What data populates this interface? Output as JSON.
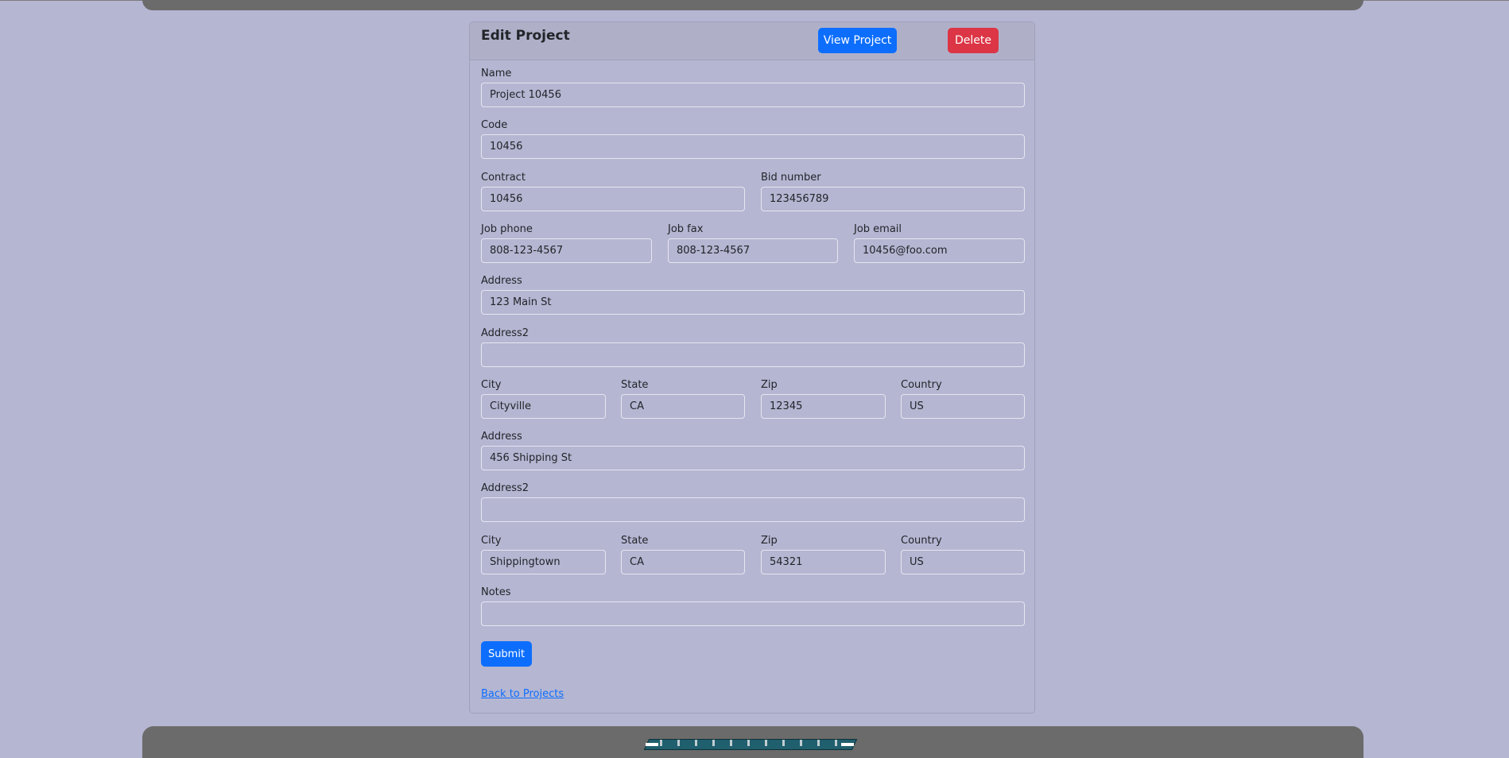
{
  "header": {
    "title": "Edit Project",
    "view_label": "View Project",
    "delete_label": "Delete"
  },
  "form": {
    "name": {
      "label": "Name",
      "value": "Project 10456"
    },
    "code": {
      "label": "Code",
      "value": "10456"
    },
    "contract": {
      "label": "Contract",
      "value": "10456"
    },
    "bid_number": {
      "label": "Bid number",
      "value": "123456789"
    },
    "job_phone": {
      "label": "Job phone",
      "value": "808-123-4567"
    },
    "job_fax": {
      "label": "Job fax",
      "value": "808-123-4567"
    },
    "job_email": {
      "label": "Job email",
      "value": "10456@foo.com"
    },
    "address": {
      "label": "Address",
      "value": "123 Main St"
    },
    "address2": {
      "label": "Address2",
      "value": ""
    },
    "city": {
      "label": "City",
      "value": "Cityville"
    },
    "state": {
      "label": "State",
      "value": "CA"
    },
    "zip": {
      "label": "Zip",
      "value": "12345"
    },
    "country": {
      "label": "Country",
      "value": "US"
    },
    "ship_address": {
      "label": "Address",
      "value": "456 Shipping St"
    },
    "ship_address2": {
      "label": "Address2",
      "value": ""
    },
    "ship_city": {
      "label": "City",
      "value": "Shippingtown"
    },
    "ship_state": {
      "label": "State",
      "value": "CA"
    },
    "ship_zip": {
      "label": "Zip",
      "value": "54321"
    },
    "ship_country": {
      "label": "Country",
      "value": "US"
    },
    "notes": {
      "label": "Notes",
      "value": ""
    },
    "submit_label": "Submit"
  },
  "footer": {
    "back_link": "Back to Projects"
  },
  "colors": {
    "primary": "#0d6efd",
    "danger": "#dc3545",
    "background": "#b5b6d2",
    "bar": "#6b6b6b"
  }
}
